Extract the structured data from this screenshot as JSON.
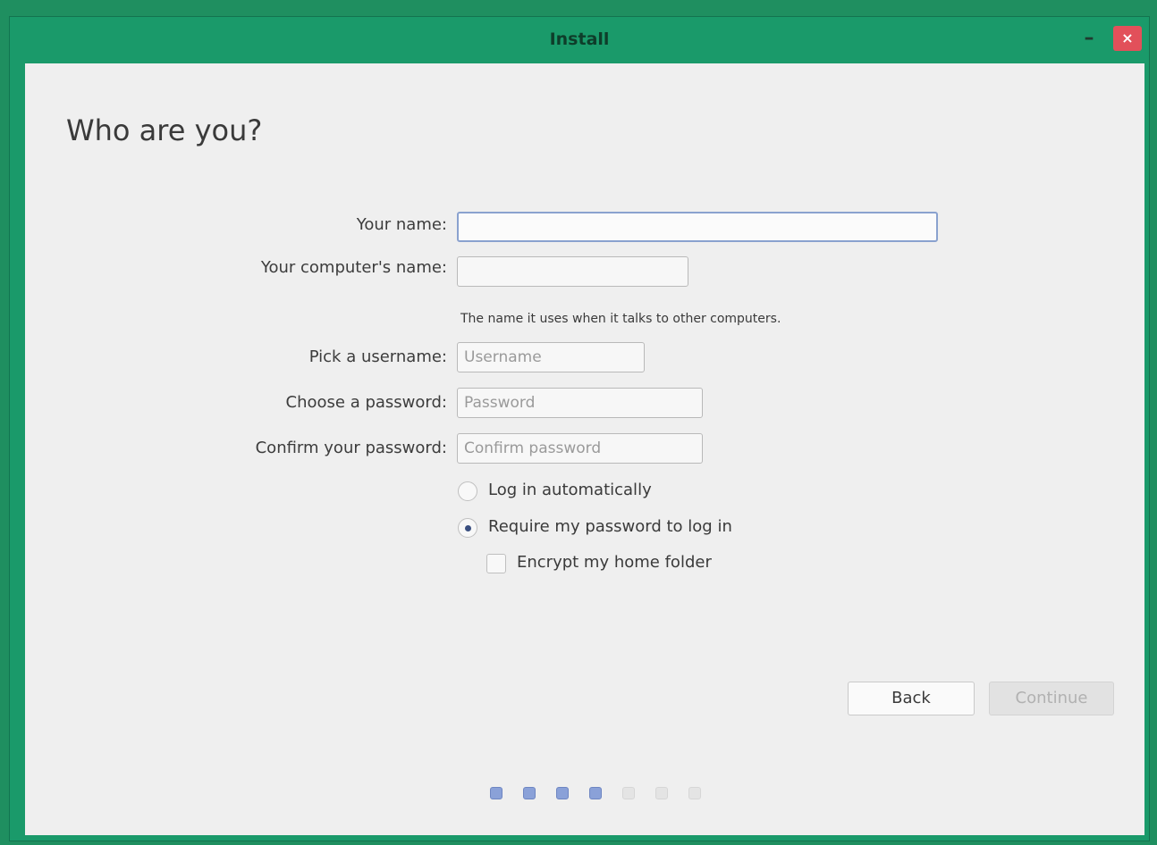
{
  "window": {
    "title": "Install",
    "minimize_symbol": "–",
    "close_symbol": "×"
  },
  "page": {
    "heading": "Who are you?"
  },
  "form": {
    "your_name_label": "Your name:",
    "your_name_value": "",
    "computer_name_label": "Your computer's name:",
    "computer_name_value": "",
    "computer_name_hint": "The name it uses when it talks to other computers.",
    "username_label": "Pick a username:",
    "username_placeholder": "Username",
    "password_label": "Choose a password:",
    "password_placeholder": "Password",
    "confirm_label": "Confirm your password:",
    "confirm_placeholder": "Confirm password"
  },
  "login_options": {
    "auto_login_label": "Log in automatically",
    "auto_login_selected": false,
    "require_password_label": "Require my password to log in",
    "require_password_selected": true,
    "encrypt_home_label": "Encrypt my home folder",
    "encrypt_home_checked": false
  },
  "buttons": {
    "back_label": "Back",
    "continue_label": "Continue",
    "continue_enabled": false
  },
  "progress": {
    "total_steps": 7,
    "completed_steps": 4
  },
  "colors": {
    "titlebar": "#1a9a6a",
    "close_button": "#e2505a",
    "content_background": "#efefef",
    "progress_done": "#8aa1d8",
    "progress_todo": "#e4e4e4"
  }
}
